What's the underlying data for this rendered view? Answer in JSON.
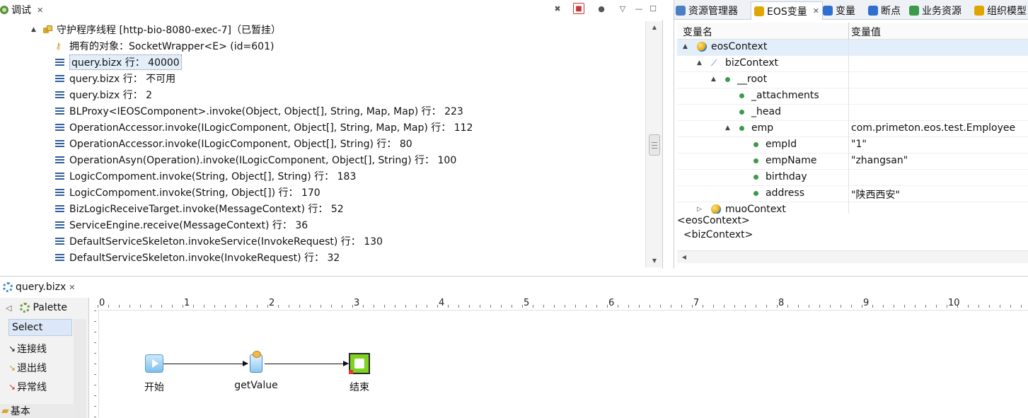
{
  "debug_view": {
    "tab_label": "调试",
    "tree": [
      {
        "kind": "thread",
        "label": "守护程序线程 [http-bio-8080-exec-7]（已暂挂）"
      },
      {
        "kind": "monitor",
        "label": "拥有的对象：SocketWrapper<E>  (id=601)"
      },
      {
        "kind": "frame",
        "label": "query.bizx 行： 40000",
        "selected": true
      },
      {
        "kind": "frame",
        "label": "query.bizx 行： 不可用"
      },
      {
        "kind": "frame",
        "label": "query.bizx 行： 2"
      },
      {
        "kind": "frame",
        "label": "BLProxy<IEOSComponent>.invoke(Object, Object[], String, Map, Map) 行： 223"
      },
      {
        "kind": "frame",
        "label": "OperationAccessor.invoke(ILogicComponent, Object[], String, Map, Map) 行： 112"
      },
      {
        "kind": "frame",
        "label": "OperationAccessor.invoke(ILogicComponent, Object[], String) 行： 80"
      },
      {
        "kind": "frame",
        "label": "OperationAsyn(Operation).invoke(ILogicComponent, Object[], String) 行： 100"
      },
      {
        "kind": "frame",
        "label": "LogicCompoment.invoke(String, Object[], String) 行： 183"
      },
      {
        "kind": "frame",
        "label": "LogicCompoment.invoke(String, Object[]) 行： 170"
      },
      {
        "kind": "frame",
        "label": "BizLogicReceiveTarget.invoke(MessageContext) 行： 52"
      },
      {
        "kind": "frame",
        "label": "ServiceEngine.receive(MessageContext) 行： 36"
      },
      {
        "kind": "frame",
        "label": "DefaultServiceSkeleton.invokeService(InvokeRequest) 行： 130"
      },
      {
        "kind": "frame",
        "label": "DefaultServiceSkeleton.invoke(InvokeRequest) 行： 32"
      }
    ]
  },
  "vars_view": {
    "tabs": [
      {
        "label": "资源管理器",
        "icon": "explorer-icon",
        "color": "#4a7fc1"
      },
      {
        "label": "EOS变量",
        "icon": "eos-variables-icon",
        "color": "#e0a600",
        "active": true
      },
      {
        "label": "变量",
        "icon": "variables-icon",
        "color": "#2f6fcf"
      },
      {
        "label": "断点",
        "icon": "breakpoints-icon",
        "color": "#2f6fcf"
      },
      {
        "label": "业务资源",
        "icon": "business-resource-icon",
        "color": "#3d9a4a"
      },
      {
        "label": "组织模型",
        "icon": "org-model-icon",
        "color": "#e0a600"
      }
    ],
    "col_name": "变量名",
    "col_value": "变量值",
    "rows": [
      {
        "name": "eosContext",
        "value": "",
        "icon": "globe",
        "expander": "▲",
        "selected": true
      },
      {
        "name": "bizContext",
        "value": "",
        "icon": "link",
        "expander": "▲"
      },
      {
        "name": "__root",
        "value": "",
        "icon": "dot",
        "expander": "▲"
      },
      {
        "name": "_attachments",
        "value": "",
        "icon": "dot",
        "expander": ""
      },
      {
        "name": "_head",
        "value": "",
        "icon": "dot",
        "expander": ""
      },
      {
        "name": "emp",
        "value": "com.primeton.eos.test.Employee",
        "icon": "dot",
        "expander": "▲"
      },
      {
        "name": "empId",
        "value": "\"1\"",
        "icon": "dot",
        "expander": ""
      },
      {
        "name": "empName",
        "value": "\"zhangsan\"",
        "icon": "dot",
        "expander": ""
      },
      {
        "name": "birthday",
        "value": "",
        "icon": "dot",
        "expander": ""
      },
      {
        "name": "address",
        "value": "\"陕西西安\"",
        "icon": "dot",
        "expander": ""
      },
      {
        "name": "muoContext",
        "value": "",
        "icon": "globe",
        "expander": "▷"
      }
    ],
    "detail": [
      "<eosContext>",
      "  <bizContext>"
    ]
  },
  "editor": {
    "tab_label": "query.bizx",
    "palette": {
      "title": "Palette",
      "select_label": "Select",
      "items": [
        "连接线",
        "退出线",
        "异常线"
      ],
      "group_label": "基本"
    },
    "ruler_labels": [
      "0",
      "1",
      "2",
      "3",
      "4",
      "5",
      "6",
      "7",
      "8",
      "9",
      "10"
    ],
    "nodes": {
      "start": "开始",
      "getvalue": "getValue",
      "end": "结束"
    }
  }
}
